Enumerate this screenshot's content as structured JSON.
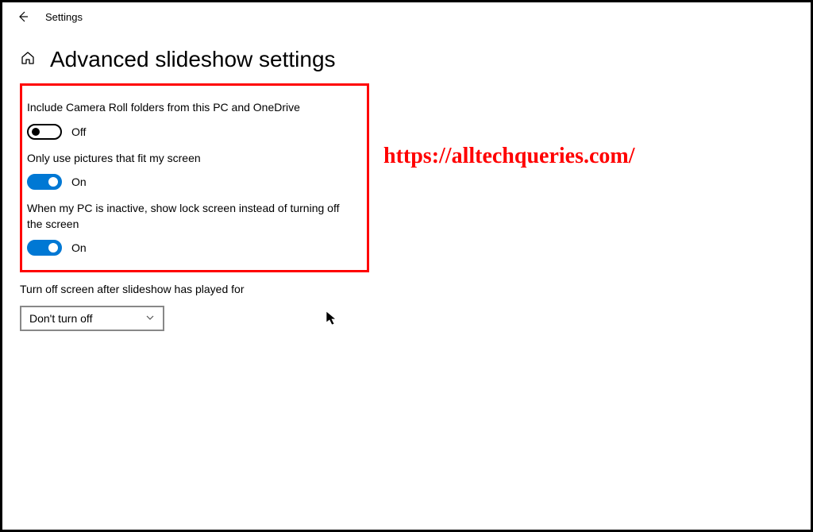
{
  "header": {
    "title": "Settings"
  },
  "page": {
    "title": "Advanced slideshow settings"
  },
  "settings": {
    "cameraRoll": {
      "label": "Include Camera Roll folders from this PC and OneDrive",
      "state": "Off",
      "on": false
    },
    "fitScreen": {
      "label": "Only use pictures that fit my screen",
      "state": "On",
      "on": true
    },
    "lockScreen": {
      "label": "When my PC is inactive, show lock screen instead of turning off the screen",
      "state": "On",
      "on": true
    },
    "turnOff": {
      "label": "Turn off screen after slideshow has played for",
      "selected": "Don't turn off"
    }
  },
  "watermark": "https://alltechqueries.com/"
}
